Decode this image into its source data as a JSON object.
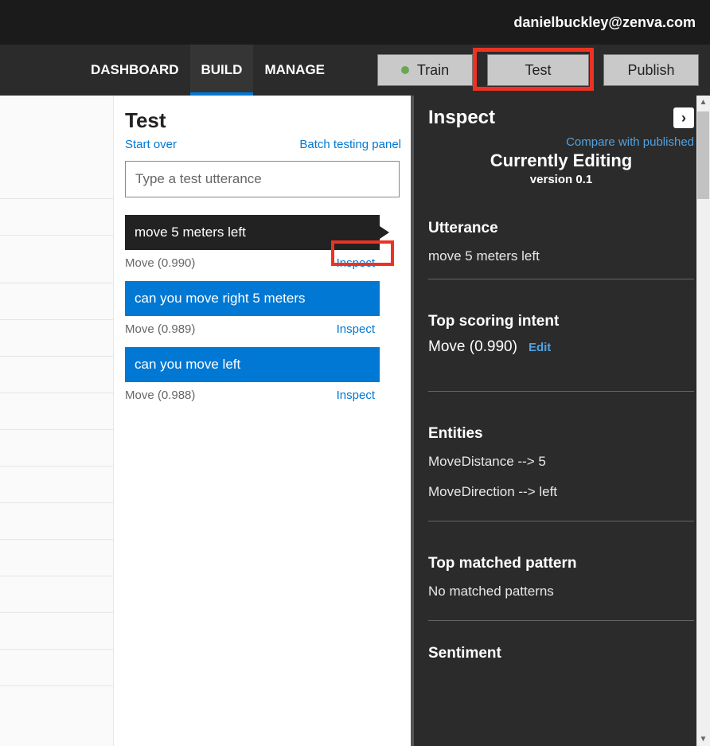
{
  "header": {
    "user_email": "danielbuckley@zenva.com"
  },
  "nav": {
    "dashboard": "DASHBOARD",
    "build": "BUILD",
    "manage": "MANAGE",
    "train": "Train",
    "test": "Test",
    "publish": "Publish"
  },
  "test_panel": {
    "title": "Test",
    "start_over": "Start over",
    "batch_link": "Batch testing panel",
    "input_placeholder": "Type a test utterance",
    "inspect_label": "Inspect",
    "utterances": [
      {
        "text": "move 5 meters left",
        "score": "Move (0.990)",
        "style": "dark"
      },
      {
        "text": "can you move right 5 meters",
        "score": "Move (0.989)",
        "style": "blue"
      },
      {
        "text": "can you move left",
        "score": "Move (0.988)",
        "style": "blue"
      }
    ]
  },
  "inspect_panel": {
    "title": "Inspect",
    "compare": "Compare with published",
    "currently_editing": "Currently Editing",
    "version": "version 0.1",
    "utterance_h": "Utterance",
    "utterance_text": "move 5 meters left",
    "top_intent_h": "Top scoring intent",
    "top_intent_value": "Move (0.990)",
    "edit": "Edit",
    "entities_h": "Entities",
    "entities": [
      "MoveDistance --> 5",
      "MoveDirection --> left"
    ],
    "top_pattern_h": "Top matched pattern",
    "top_pattern_value": "No matched patterns",
    "sentiment_h": "Sentiment"
  }
}
